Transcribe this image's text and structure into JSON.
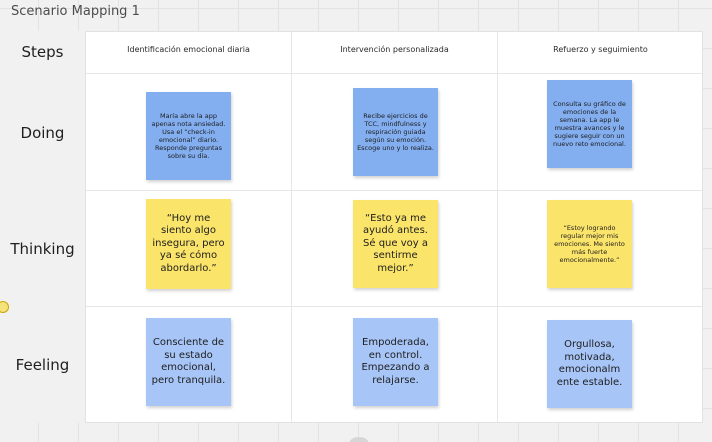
{
  "frame": {
    "title": "Scenario Mapping 1"
  },
  "rows": {
    "steps": "Steps",
    "doing": "Doing",
    "thinking": "Thinking",
    "feeling": "Feeling"
  },
  "steps": [
    "Identificación emocional diaria",
    "Intervención personalizada",
    "Refuerzo y seguimiento"
  ],
  "doing": [
    "María abre la app apenas nota ansiedad. Usa el “check-in emocional” diario. Responde preguntas sobre su día.",
    "Recibe ejercicios de TCC, mindfulness y respiración guiada según su emoción. Escoge uno y lo realiza.",
    "Consulta su gráfico de emociones de la semana. La app le muestra avances y le sugiere seguir con un nuevo reto emocional."
  ],
  "thinking": [
    "“Hoy me siento algo insegura, pero ya sé cómo abordarlo.”",
    "“Esto ya me ayudó antes. Sé que voy a sentirme mejor.”",
    "“Estoy logrando regular mejor mis emociones. Me siento más fuerte emocionalmente.”"
  ],
  "feeling": [
    "Consciente de su estado emocional, pero tranquila.",
    "Empoderada, en control. Empezando a relajarse.",
    "Orgullosa, motivada, emocionalm ente estable."
  ],
  "colors": {
    "doing_note": "#83aef0",
    "feeling_note": "#a7c5f7",
    "thinking_note": "#fbe46a",
    "canvas": "#f1f1f1"
  }
}
